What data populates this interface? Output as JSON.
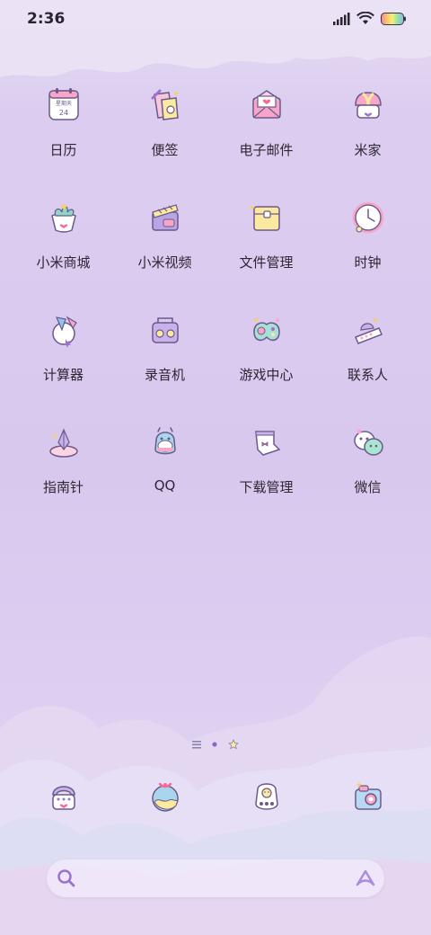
{
  "status_bar": {
    "time": "2:36",
    "icons": [
      "signal-icon",
      "wifi-icon",
      "battery-icon"
    ]
  },
  "apps": [
    {
      "label": "日历",
      "icon": "calendar-icon",
      "calendar_text": "星期天",
      "calendar_date": "24"
    },
    {
      "label": "便签",
      "icon": "notes-icon"
    },
    {
      "label": "电子邮件",
      "icon": "email-icon"
    },
    {
      "label": "米家",
      "icon": "mihome-icon"
    },
    {
      "label": "小米商城",
      "icon": "mall-icon"
    },
    {
      "label": "小米视频",
      "icon": "video-icon"
    },
    {
      "label": "文件管理",
      "icon": "folder-icon"
    },
    {
      "label": "时钟",
      "icon": "clock-icon"
    },
    {
      "label": "计算器",
      "icon": "calculator-icon"
    },
    {
      "label": "录音机",
      "icon": "recorder-icon"
    },
    {
      "label": "游戏中心",
      "icon": "gamepad-icon"
    },
    {
      "label": "联系人",
      "icon": "contacts-icon"
    },
    {
      "label": "指南针",
      "icon": "compass-icon"
    },
    {
      "label": "QQ",
      "icon": "qq-icon"
    },
    {
      "label": "下载管理",
      "icon": "download-icon"
    },
    {
      "label": "微信",
      "icon": "wechat-icon"
    }
  ],
  "page_indicator": {
    "pages": 2,
    "current": 1
  },
  "dock": [
    {
      "icon": "phone-icon"
    },
    {
      "icon": "browser-icon"
    },
    {
      "icon": "messages-icon"
    },
    {
      "icon": "camera-icon"
    }
  ],
  "colors": {
    "accent": "#9b72cf",
    "pink": "#f7a6c7",
    "yellow": "#fbe9a0",
    "lavender": "#d8c8ee"
  }
}
